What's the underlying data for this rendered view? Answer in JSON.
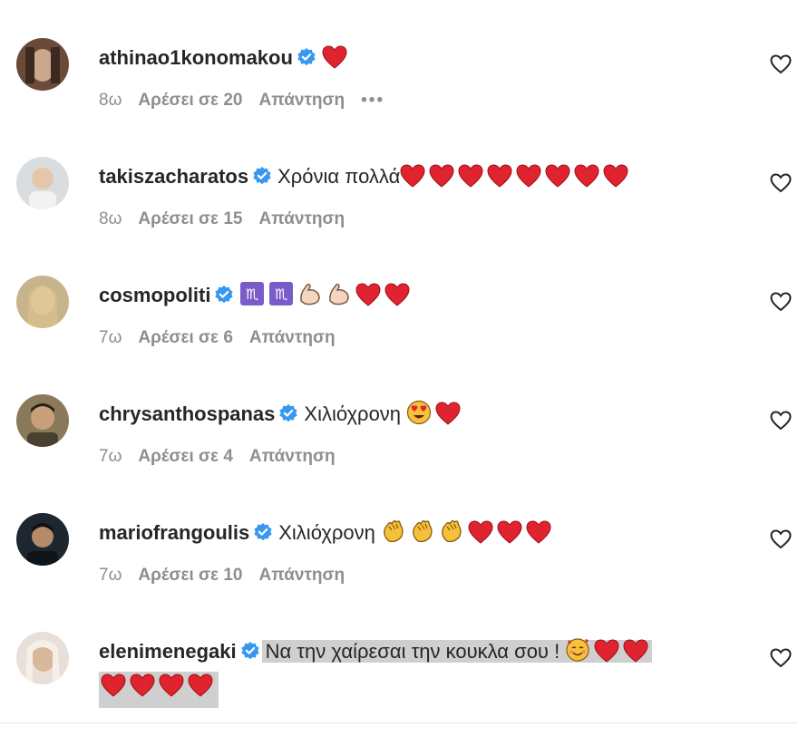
{
  "comments": [
    {
      "username": "athinao1konomakou",
      "text": "",
      "emojis": [
        "red-heart"
      ],
      "time": "8ω",
      "likes": "Αρέσει σε 20",
      "reply": "Απάντηση",
      "more": "•••",
      "avatar_colors": [
        "#6b4a3a",
        "#c9a98a"
      ]
    },
    {
      "username": "takiszacharatos",
      "text": "Χρόνια πολλά",
      "emojis": [
        "red-heart",
        "red-heart",
        "red-heart",
        "red-heart",
        "red-heart",
        "red-heart",
        "red-heart",
        "red-heart"
      ],
      "time": "8ω",
      "likes": "Αρέσει σε 15",
      "reply": "Απάντηση",
      "avatar_colors": [
        "#d9dde0",
        "#e6c6a8"
      ]
    },
    {
      "username": "cosmopoliti",
      "text": "",
      "emojis": [
        "scorpio",
        "scorpio",
        "flexed-biceps",
        "flexed-biceps",
        "red-heart",
        "red-heart"
      ],
      "time": "7ω",
      "likes": "Αρέσει σε 6",
      "reply": "Απάντηση",
      "avatar_colors": [
        "#c8b48c",
        "#f0d7b8"
      ]
    },
    {
      "username": "chrysanthospanas",
      "text": "Χιλιόχρονη",
      "emojis": [
        "heart-eyes-face",
        "red-heart"
      ],
      "time": "7ω",
      "likes": "Αρέσει σε 4",
      "reply": "Απάντηση",
      "avatar_colors": [
        "#8a7a5a",
        "#c9a07a"
      ]
    },
    {
      "username": "mariofrangoulis",
      "text": "Χιλιόχρονη",
      "emojis": [
        "clapping-hands",
        "clapping-hands",
        "clapping-hands",
        "red-heart",
        "red-heart",
        "red-heart"
      ],
      "time": "7ω",
      "likes": "Αρέσει σε 10",
      "reply": "Απάντηση",
      "avatar_colors": [
        "#1e2630",
        "#b58a6a"
      ]
    },
    {
      "username": "elenimenegaki",
      "text": "Να την χαίρεσαι την κουκλα σου ! ",
      "emojis": [
        "smiling-face-with-hearts",
        "red-heart",
        "red-heart"
      ],
      "emojis_line2": [
        "red-heart",
        "red-heart",
        "red-heart",
        "red-heart"
      ],
      "avatar_colors": [
        "#e8e0d8",
        "#d8b89a"
      ]
    }
  ],
  "colors": {
    "verified": "#3897f0",
    "heart": "#e0242f",
    "meta": "#8e8e8e",
    "highlight": "#cfcfcf"
  }
}
